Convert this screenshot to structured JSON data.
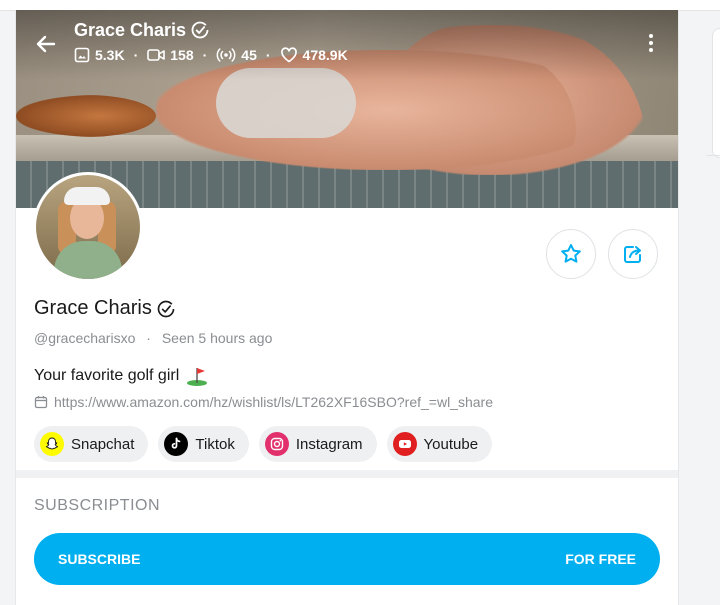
{
  "profile": {
    "name": "Grace Charis",
    "handle": "@gracecharisxo",
    "seen_label": "Seen",
    "last_seen": "5 hours ago",
    "bio": "Your favorite golf girl",
    "link": "https://www.amazon.com/hz/wishlist/ls/LT262XF16SBO?ref_=wl_share"
  },
  "stats": {
    "images": "5.3K",
    "videos": "158",
    "streams": "45",
    "likes": "478.9K"
  },
  "socials": [
    {
      "label": "Snapchat",
      "icon": "snapchat-icon",
      "color": "#fffc00"
    },
    {
      "label": "Tiktok",
      "icon": "tiktok-icon",
      "color": "#000000"
    },
    {
      "label": "Instagram",
      "icon": "instagram-icon",
      "color": "#e1306c"
    },
    {
      "label": "Youtube",
      "icon": "youtube-icon",
      "color": "#e02020"
    }
  ],
  "subscription": {
    "section_label": "SUBSCRIPTION",
    "button_label": "SUBSCRIBE",
    "price_label": "FOR FREE"
  },
  "colors": {
    "accent": "#00aff0",
    "muted_text": "#8a8d91"
  }
}
